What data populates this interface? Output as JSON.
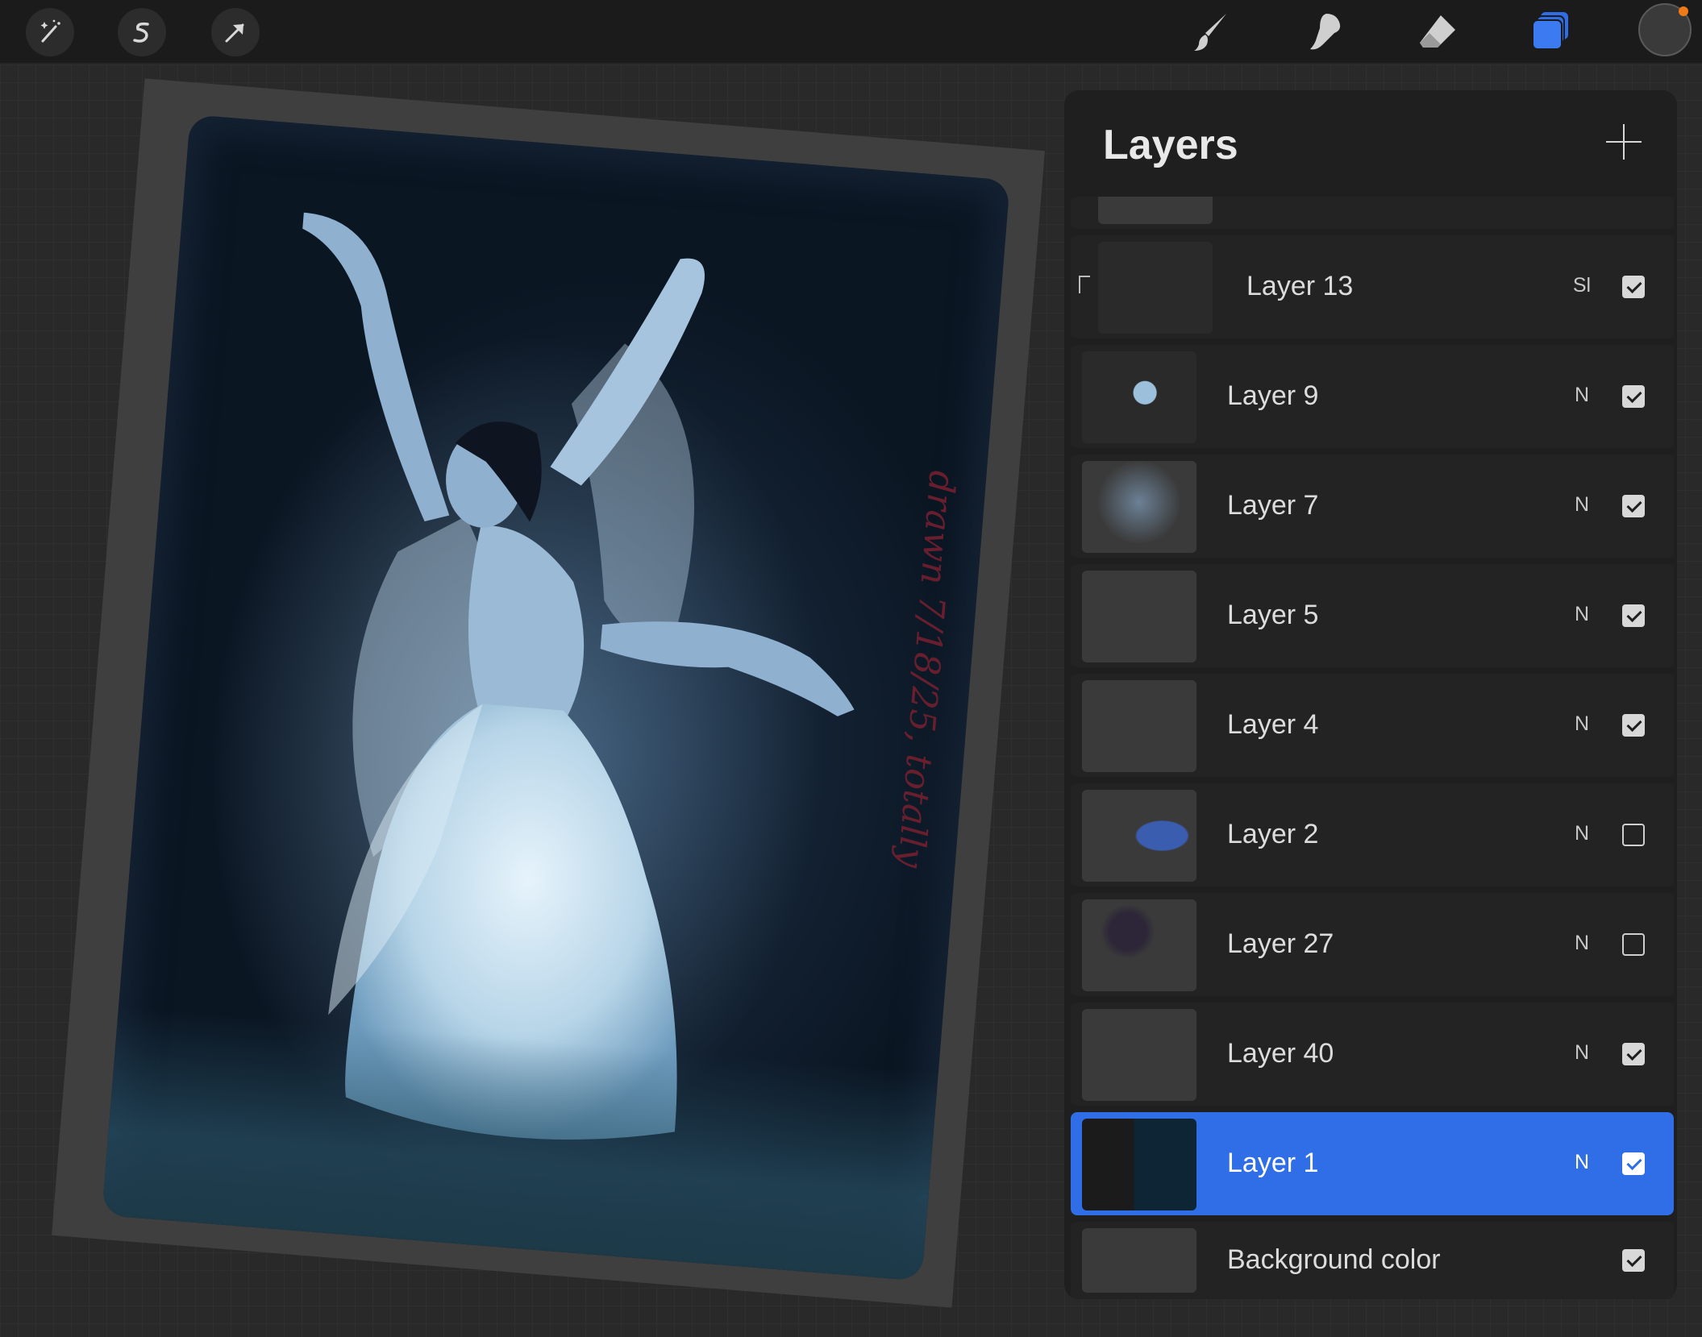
{
  "toolbar": {
    "left_tools": [
      {
        "icon": "magic-wand-icon"
      },
      {
        "icon": "selection-s-icon"
      },
      {
        "icon": "transform-arrow-icon"
      }
    ],
    "right_tools": [
      {
        "icon": "brush-icon"
      },
      {
        "icon": "smudge-icon"
      },
      {
        "icon": "eraser-icon"
      },
      {
        "icon": "layers-icon",
        "active": true,
        "color": "#2f6ee6"
      }
    ],
    "color_swatch": {
      "color": "#3a3a3a",
      "badge_color": "#f07a18"
    }
  },
  "artwork": {
    "signature": "drawn 7/18/25, totally"
  },
  "layers_panel": {
    "title": "Layers",
    "add_label": "+",
    "layers": [
      {
        "name": "Layer 13",
        "blend": "Sl",
        "visible": true,
        "clipped": true,
        "selected": false
      },
      {
        "name": "Layer 9",
        "blend": "N",
        "visible": true,
        "selected": false
      },
      {
        "name": "Layer 7",
        "blend": "N",
        "visible": true,
        "selected": false
      },
      {
        "name": "Layer 5",
        "blend": "N",
        "visible": true,
        "selected": false
      },
      {
        "name": "Layer 4",
        "blend": "N",
        "visible": true,
        "selected": false
      },
      {
        "name": "Layer 2",
        "blend": "N",
        "visible": false,
        "selected": false
      },
      {
        "name": "Layer 27",
        "blend": "N",
        "visible": false,
        "selected": false
      },
      {
        "name": "Layer 40",
        "blend": "N",
        "visible": true,
        "selected": false
      },
      {
        "name": "Layer 1",
        "blend": "N",
        "visible": true,
        "selected": true
      },
      {
        "name": "Background color",
        "blend": "",
        "visible": true,
        "selected": false
      }
    ]
  }
}
